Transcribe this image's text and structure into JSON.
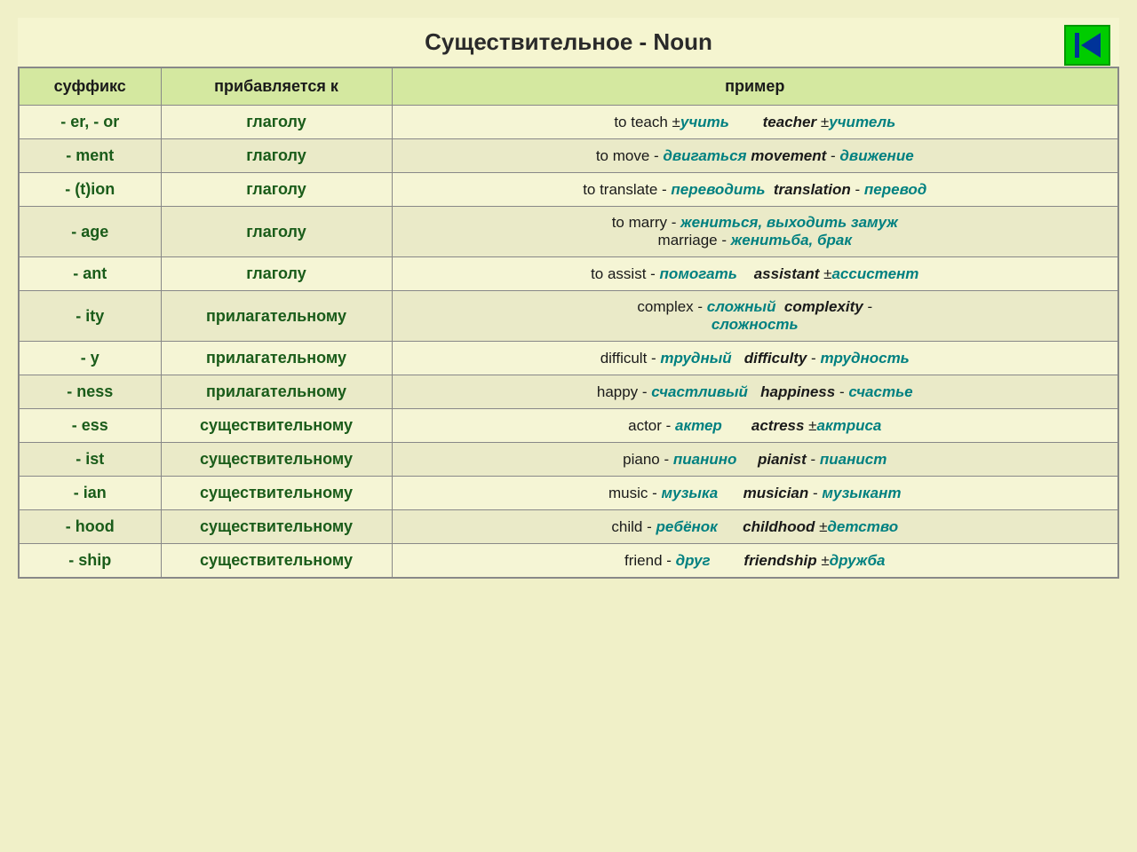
{
  "title": "Существительное - Noun",
  "nav_button_label": "back",
  "table": {
    "headers": [
      "суффикс",
      "прибавляется к",
      "пример"
    ],
    "rows": [
      {
        "suffix": "- er, - or",
        "added_to": "глаголу",
        "example_html": "to teach ±<i><b style='color:#008080'>учить</b></i>&nbsp;&nbsp;&nbsp;&nbsp;&nbsp;&nbsp;&nbsp;&nbsp;<i><b>teacher</b></i> ±<i><b style='color:#008080'>учитель</b></i>"
      },
      {
        "suffix": "- ment",
        "added_to": "глаголу",
        "example_html": "to move - <i><b style='color:#008080'>двигаться</b></i> <i><b>movement</b></i> - <i><b style='color:#008080'>движение</b></i>"
      },
      {
        "suffix": "- (t)ion",
        "added_to": "глаголу",
        "example_html": "to translate - <i><b style='color:#008080'>переводить</b></i>&nbsp; <i><b>translation</b></i> - <i><b style='color:#008080'>перевод</b></i>"
      },
      {
        "suffix": "- age",
        "added_to": "глаголу",
        "example_html": "to marry - <i><b style='color:#008080'>жениться, выходить замуж</b></i><br>marriage - <i><b style='color:#008080'>женитьба, брак</b></i>"
      },
      {
        "suffix": "- ant",
        "added_to": "глаголу",
        "example_html": "to assist - <i><b style='color:#008080'>помогать</b></i>&nbsp;&nbsp;&nbsp; <i><b>assistant</b></i> ±<i><b style='color:#008080'>ассистент</b></i>"
      },
      {
        "suffix": "- ity",
        "added_to": "прилагательному",
        "example_html": "complex - <i><b style='color:#008080'>сложный</b></i>&nbsp; <i><b>complexity</b></i> -<br><i><b style='color:#008080'>сложность</b></i>"
      },
      {
        "suffix": "- y",
        "added_to": "прилагательному",
        "example_html": "difficult - <i><b style='color:#008080'>трудный</b></i>&nbsp;&nbsp; <i><b>difficulty</b></i> - <i><b style='color:#008080'>трудность</b></i>"
      },
      {
        "suffix": "- ness",
        "added_to": "прилагательному",
        "example_html": "happy - <i><b style='color:#008080'>счастливый</b></i>&nbsp;&nbsp; <i><b>happiness</b></i> - <i><b style='color:#008080'>счастье</b></i>"
      },
      {
        "suffix": "- ess",
        "added_to": "существительному",
        "example_html": "actor - <i><b style='color:#008080'>актер</b></i>&nbsp;&nbsp;&nbsp;&nbsp;&nbsp;&nbsp; <i><b>actress</b></i> ±<i><b style='color:#008080'>актриса</b></i>"
      },
      {
        "suffix": "- ist",
        "added_to": "существительному",
        "example_html": "piano - <i><b style='color:#008080'>пианино</b></i>&nbsp;&nbsp;&nbsp;&nbsp; <i><b>pianist</b></i> - <i><b style='color:#008080'>пианист</b></i>"
      },
      {
        "suffix": "- ian",
        "added_to": "существительному",
        "example_html": "music - <i><b style='color:#008080'>музыка</b></i>&nbsp;&nbsp;&nbsp;&nbsp;&nbsp; <i><b>musician</b></i> - <i><b style='color:#008080'>музыкант</b></i>"
      },
      {
        "suffix": "- hood",
        "added_to": "существительному",
        "example_html": "child - <i><b style='color:#008080'>ребёнок</b></i>&nbsp;&nbsp;&nbsp;&nbsp;&nbsp; <i><b>childhood</b></i> ±<i><b style='color:#008080'>детство</b></i>"
      },
      {
        "suffix": "- ship",
        "added_to": "существительному",
        "example_html": "friend - <i><b style='color:#008080'>друг</b></i>&nbsp;&nbsp;&nbsp;&nbsp;&nbsp;&nbsp;&nbsp; <i><b>friendship</b></i> ±<i><b style='color:#008080'>дружба</b></i>"
      }
    ]
  }
}
